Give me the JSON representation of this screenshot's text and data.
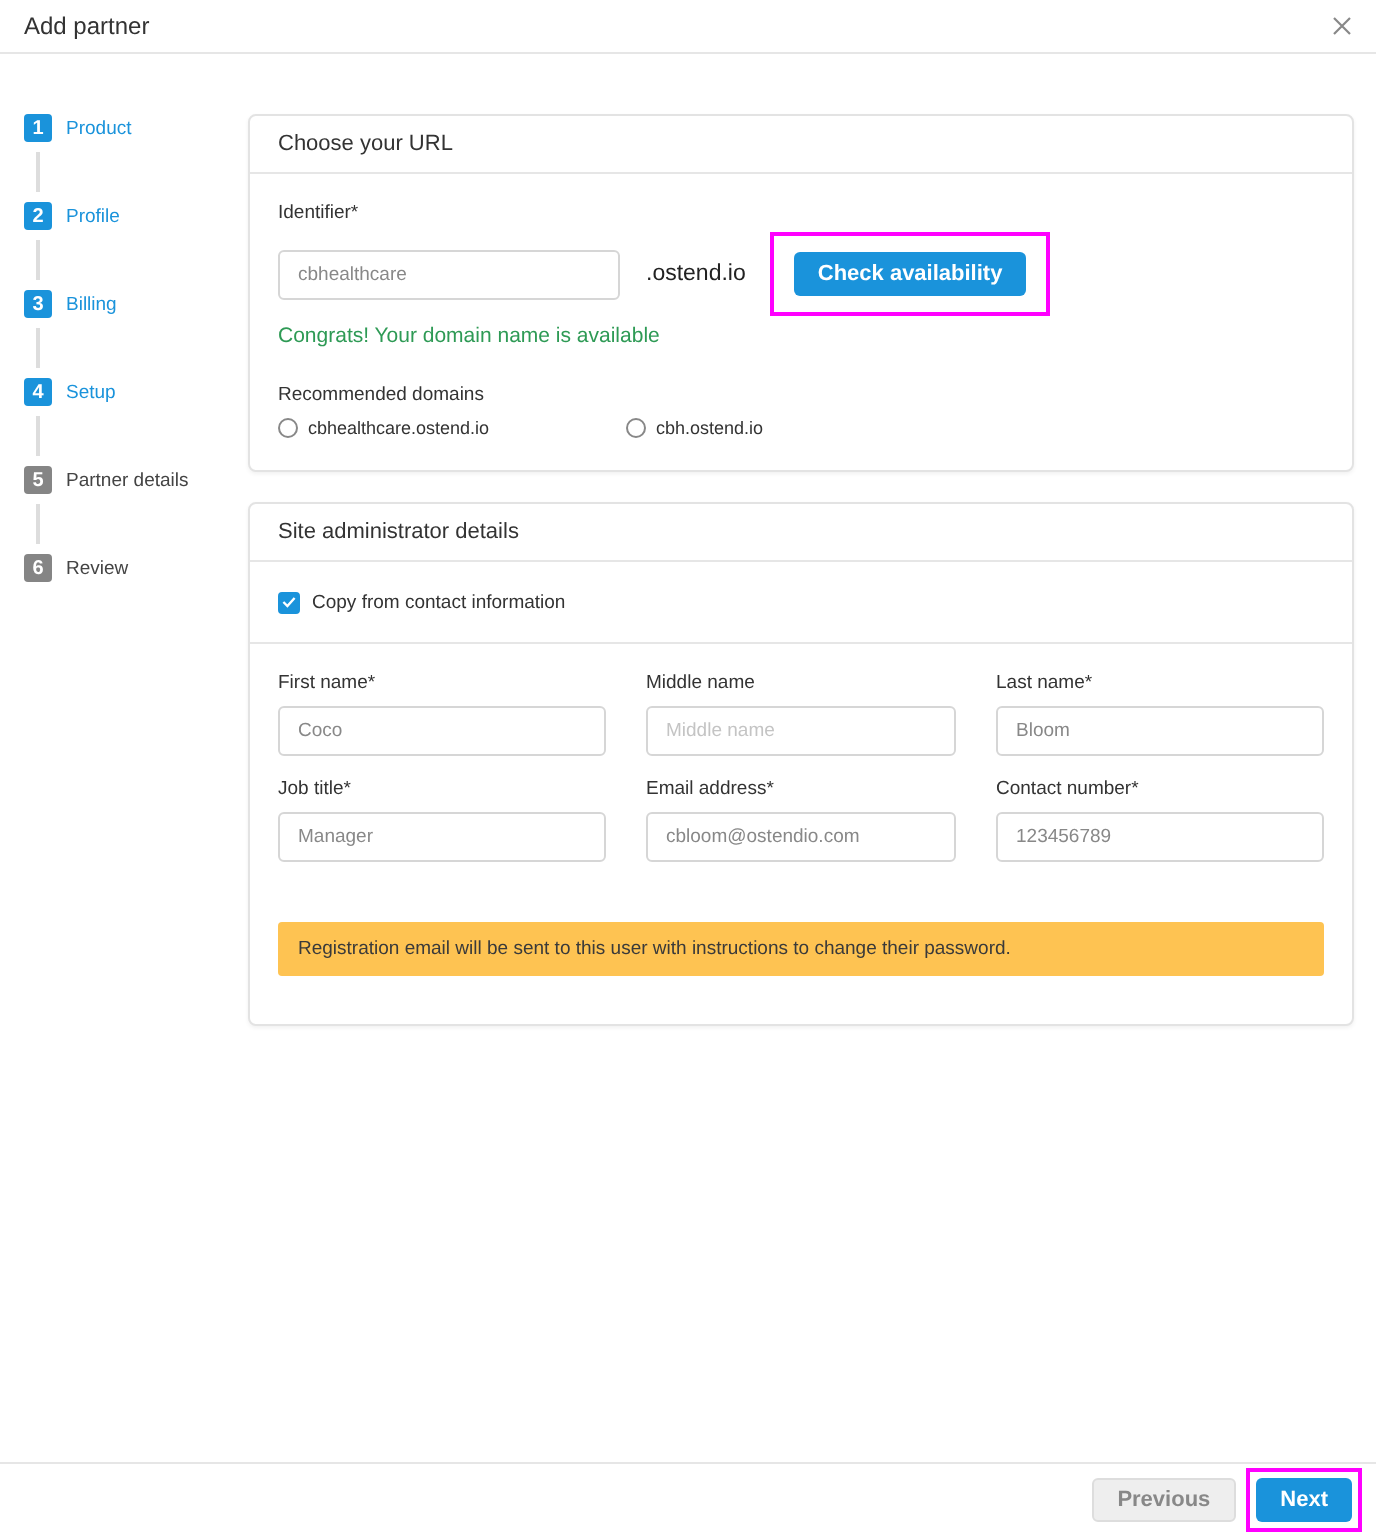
{
  "dialog": {
    "title": "Add partner"
  },
  "steps": [
    {
      "number": "1",
      "label": "Product",
      "completed": true
    },
    {
      "number": "2",
      "label": "Profile",
      "completed": true
    },
    {
      "number": "3",
      "label": "Billing",
      "completed": true
    },
    {
      "number": "4",
      "label": "Setup",
      "completed": true
    },
    {
      "number": "5",
      "label": "Partner details",
      "completed": false
    },
    {
      "number": "6",
      "label": "Review",
      "completed": false
    }
  ],
  "url_card": {
    "title": "Choose your URL",
    "identifier": {
      "label": "Identifier*",
      "value": "cbhealthcare"
    },
    "suffix": ".ostend.io",
    "check_button": {
      "label": "Check availability",
      "highlighted": true
    },
    "success_message": "Congrats! Your domain name is available",
    "recommended": {
      "label": "Recommended domains",
      "options": [
        {
          "label": "cbhealthcare.ostend.io",
          "selected": false
        },
        {
          "label": "cbh.ostend.io",
          "selected": false
        }
      ]
    }
  },
  "admin_card": {
    "title": "Site administrator details",
    "copy_checkbox": {
      "label": "Copy from contact information",
      "checked": true
    },
    "fields": [
      {
        "label": "First name*",
        "value": "Coco"
      },
      {
        "label": "Middle name",
        "placeholder": "Middle name"
      },
      {
        "label": "Last name*",
        "value": "Bloom"
      },
      {
        "label": "Job title*",
        "value": "Manager"
      },
      {
        "label": "Email address*",
        "value": "cbloom@ostendio.com"
      },
      {
        "label": "Contact number*",
        "value": "123456789"
      }
    ],
    "notice": "Registration email will be sent to this user with instructions to change their password."
  },
  "footer": {
    "buttons": [
      {
        "label": "Previous",
        "kind": "secondary",
        "disabled": true,
        "highlighted": false
      },
      {
        "label": "Next",
        "kind": "primary",
        "disabled": false,
        "highlighted": true
      }
    ]
  }
}
